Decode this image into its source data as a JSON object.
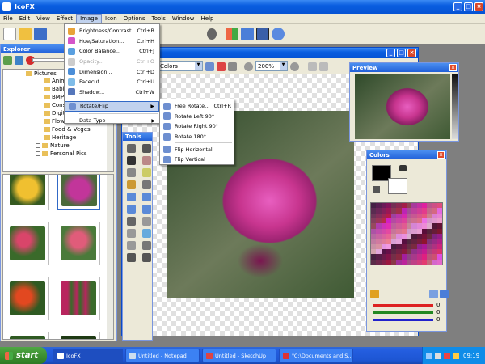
{
  "app": {
    "title": "IcoFX"
  },
  "menubar": {
    "items": [
      "File",
      "Edit",
      "View",
      "Effect",
      "Image",
      "Icon",
      "Options",
      "Tools",
      "Window",
      "Help"
    ]
  },
  "toolbar": {
    "icons": [
      "new-icon",
      "open-icon",
      "save-icon",
      "cut-icon",
      "copy-icon",
      "paste-icon",
      "apple-icon",
      "windows-logo-icon",
      "folder-icon",
      "screen-capture-icon",
      "zoom-icon"
    ]
  },
  "image_menu": {
    "items": [
      {
        "label": "Brightness/Contrast...",
        "shortcut": "Ctrl+B",
        "icon": "brightness-icon",
        "disabled": false,
        "color": "#e8a33a"
      },
      {
        "label": "Hue/Saturation...",
        "shortcut": "Ctrl+H",
        "icon": "hue-icon",
        "disabled": false,
        "color": "#d455c9"
      },
      {
        "label": "Color Balance...",
        "shortcut": "Ctrl+J",
        "icon": "color-balance-icon",
        "disabled": false,
        "color": "#5aa0e0"
      },
      {
        "label": "Opacity...",
        "shortcut": "Ctrl+O",
        "icon": "opacity-icon",
        "disabled": true,
        "color": "#cccccc"
      },
      {
        "label": "Dimension...",
        "shortcut": "Ctrl+D",
        "icon": "dimension-icon",
        "disabled": false,
        "color": "#4b8ed8"
      },
      {
        "label": "Facecut...",
        "shortcut": "Ctrl+U",
        "icon": "facecut-icon",
        "disabled": false,
        "color": "#7fbce8"
      },
      {
        "label": "Shadow...",
        "shortcut": "Ctrl+W",
        "icon": "shadow-icon",
        "disabled": false,
        "color": "#5577bb"
      },
      {
        "label": "Rotate/Flip",
        "shortcut": "",
        "icon": "rotate-icon",
        "disabled": false,
        "submenu": true,
        "color": "#6e8fd0"
      },
      {
        "label": "Data Type",
        "shortcut": "",
        "icon": "",
        "disabled": false,
        "submenu": true,
        "color": ""
      }
    ]
  },
  "rotate_submenu": {
    "items": [
      {
        "label": "Free Rotate...",
        "shortcut": "Ctrl+R"
      },
      {
        "label": "Rotate Left 90°",
        "shortcut": ""
      },
      {
        "label": "Rotate Right 90°",
        "shortcut": ""
      },
      {
        "label": "Rotate 180°",
        "shortcut": ""
      },
      {
        "label": "Flip Horizontal",
        "shortcut": ""
      },
      {
        "label": "Flip Vertical",
        "shortcut": ""
      }
    ]
  },
  "explorer": {
    "title": "Explorer",
    "tree": [
      "Pictures",
      "Anima",
      "Babies",
      "BMP",
      "Const",
      "Digital",
      "Flowe",
      "Food & Veges",
      "Heritage",
      "Nature",
      "Personal Pics"
    ],
    "thumbnails": [
      {
        "name": "yellow-rose",
        "color": "#e6b21c"
      },
      {
        "name": "pink-rose",
        "color": "#c2359a"
      },
      {
        "name": "rose-bush",
        "color": "#d9456a"
      },
      {
        "name": "pink-flowers",
        "color": "#e05c7a"
      },
      {
        "name": "red-flowers",
        "color": "#e24820"
      },
      {
        "name": "lupins",
        "color": "#b8255e"
      },
      {
        "name": "red-tulips",
        "color": "#f04018"
      },
      {
        "name": "white-flowers",
        "color": "#eaeaea"
      }
    ]
  },
  "editor": {
    "palette_select": "Colors",
    "zoom": "200%"
  },
  "tools": {
    "title": "Tools"
  },
  "preview": {
    "title": "Preview"
  },
  "colors_panel": {
    "title": "Colors",
    "slider_values": [
      "0",
      "0",
      "0"
    ]
  },
  "taskbar": {
    "start": "start",
    "tasks": [
      "IcoFX",
      "Untitled - Notepad",
      "Untitled - SketchUp",
      "\"C:\\Documents and S..."
    ],
    "clock": "09:19"
  },
  "colors": {
    "accent": "#0a5ee0",
    "rose": "#c8358f",
    "menu_highlight": "#c1d2ee"
  }
}
